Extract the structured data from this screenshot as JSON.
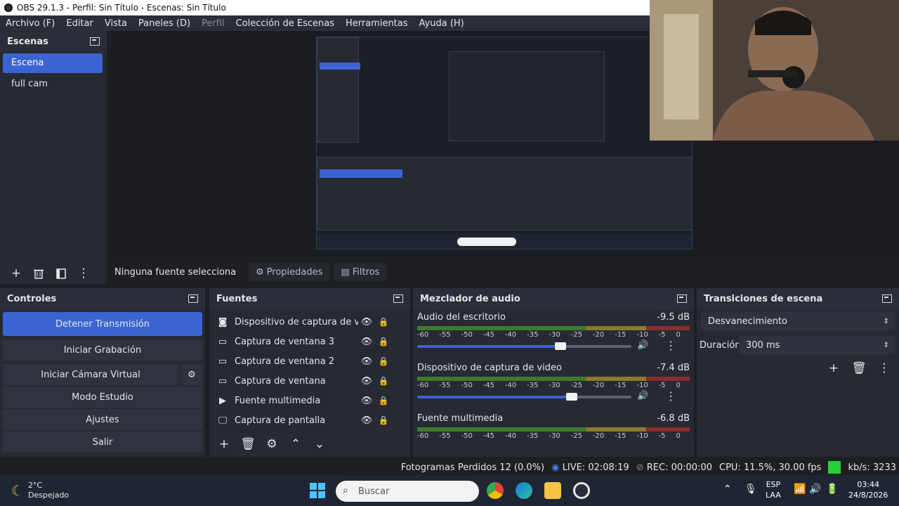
{
  "window": {
    "title": "OBS 29.1.3 - Perfil: Sin Título - Escenas: Sin Título"
  },
  "menu": [
    "Archivo (F)",
    "Editar",
    "Vista",
    "Paneles (D)",
    "Perfil",
    "Colección de Escenas",
    "Herramientas",
    "Ayuda (H)"
  ],
  "scenes": {
    "title": "Escenas",
    "items": [
      "Escena",
      "full cam"
    ],
    "selected": 0
  },
  "sourcebar": {
    "no_source": "Ninguna fuente selecciona",
    "properties": "Propiedades",
    "filters": "Filtros"
  },
  "controls": {
    "title": "Controles",
    "stop_stream": "Detener Transmisión",
    "start_record": "Iniciar Grabación",
    "virtual_cam": "Iniciar Cámara Virtual",
    "studio_mode": "Modo Estudio",
    "settings": "Ajustes",
    "exit": "Salir"
  },
  "sources": {
    "title": "Fuentes",
    "items": [
      {
        "name": "Dispositivo de captura de video",
        "icon": "camera-icon"
      },
      {
        "name": "Captura de ventana 3",
        "icon": "window-icon"
      },
      {
        "name": "Captura de ventana 2",
        "icon": "window-icon"
      },
      {
        "name": "Captura de ventana",
        "icon": "window-icon"
      },
      {
        "name": "Fuente multimedia",
        "icon": "play-icon"
      },
      {
        "name": "Captura de pantalla",
        "icon": "monitor-icon"
      }
    ]
  },
  "mixer": {
    "title": "Mezclador de audio",
    "ticks": [
      "-60",
      "-55",
      "-50",
      "-45",
      "-40",
      "-35",
      "-30",
      "-25",
      "-20",
      "-15",
      "-10",
      "-5",
      "0"
    ],
    "channels": [
      {
        "name": "Audio del escritorio",
        "db": "-9.5 dB",
        "level": 0.67
      },
      {
        "name": "Dispositivo de captura de video",
        "db": "-7.4 dB",
        "level": 0.72
      },
      {
        "name": "Fuente multimedia",
        "db": "-6.8 dB",
        "level": 0.7
      }
    ]
  },
  "transitions": {
    "title": "Transiciones de escena",
    "selected": "Desvanecimiento",
    "duration_label": "Duración",
    "duration_value": "300 ms"
  },
  "status": {
    "dropped": "Fotogramas Perdidos 12 (0.0%)",
    "live": "LIVE: 02:08:19",
    "rec": "REC: 00:00:00",
    "cpu": "CPU: 11.5%, 30.00 fps",
    "kbs": "kb/s: 3233"
  },
  "taskbar": {
    "weather_temp": "2°C",
    "weather_desc": "Despejado",
    "search_placeholder": "Buscar",
    "lang_top": "ESP",
    "lang_bottom": "LAA",
    "time": "03:44",
    "date": "24/8/2026"
  },
  "colors": {
    "accent": "#3b64d2",
    "panel": "#272a33",
    "status_ok": "#22d23a"
  }
}
